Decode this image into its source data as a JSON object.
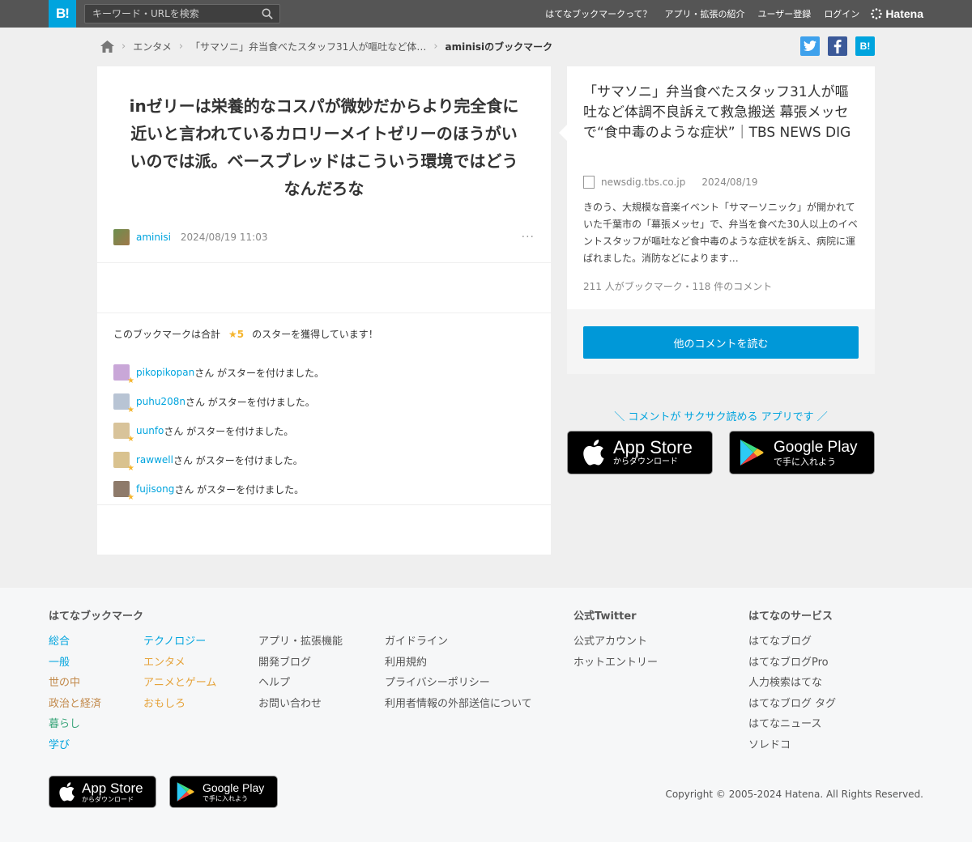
{
  "header": {
    "logo": "B!",
    "search_placeholder": "キーワード・URLを検索",
    "nav": [
      "はてなブックマークって？",
      "アプリ・拡張の紹介",
      "ユーザー登録",
      "ログイン"
    ],
    "brand": "Hatena"
  },
  "breadcrumb": {
    "items": [
      "エンタメ",
      "「サマソニ」弁当食べたスタッフ31人が嘔吐など体…",
      "aminisiのブックマーク"
    ]
  },
  "share": {
    "hatena": "B!"
  },
  "comment": {
    "text": "inゼリーは栄養的なコスパが微妙だからより完全食に近いと言われているカロリーメイトゼリーのほうがいいのでは派。ベースブレッドはこういう環境ではどうなんだろな",
    "user": "aminisi",
    "date": "2024/08/19 11:03",
    "more": "···"
  },
  "stars": {
    "summary_pre": "このブックマークは合計",
    "summary_count": "★5",
    "summary_post": "のスターを獲得しています！",
    "suffix": "さん がスターを付けました。",
    "users": [
      {
        "name": "pikopikopan",
        "color": "#c9a7d8"
      },
      {
        "name": "puhu208n",
        "color": "#b8c4d4"
      },
      {
        "name": "uunfo",
        "color": "#d8c39a"
      },
      {
        "name": "rawwell",
        "color": "#d9c28f"
      },
      {
        "name": "fujisong",
        "color": "#8e7a6a"
      }
    ]
  },
  "entry": {
    "title": "「サマソニ」弁当食べたスタッフ31人が嘔吐など体調不良訴えて救急搬送 幕張メッセで“食中毒のような症状”｜TBS NEWS DIG",
    "domain": "newsdig.tbs.co.jp",
    "date": "2024/08/19",
    "summary": "きのう、大規模な音楽イベント「サマーソニック」が開かれていた千葉市の「幕張メッセ」で、弁当を食べた30人以上のイベントスタッフが嘔吐など食中毒のような症状を訴え、病院に運ばれました。消防などによります…",
    "counts": "211 人がブックマーク・118 件のコメント",
    "cta": "他のコメントを読む"
  },
  "promo": {
    "text": "＼ コメントが サクサク読める アプリです ／",
    "appstore_big": "App Store",
    "appstore_small": "からダウンロード",
    "googleplay_big": "Google Play",
    "googleplay_small": "で手に入れよう"
  },
  "footer": {
    "col1_title": "はてなブックマーク",
    "col1": [
      "総合",
      "一般",
      "世の中",
      "政治と経済",
      "暮らし",
      "学び"
    ],
    "col2": [
      "テクノロジー",
      "エンタメ",
      "アニメとゲーム",
      "おもしろ"
    ],
    "col3": [
      "アプリ・拡張機能",
      "開発ブログ",
      "ヘルプ",
      "お問い合わせ"
    ],
    "col4": [
      "ガイドライン",
      "利用規約",
      "プライバシーポリシー",
      "利用者情報の外部送信について"
    ],
    "twitter_title": "公式Twitter",
    "twitter": [
      "公式アカウント",
      "ホットエントリー"
    ],
    "services_title": "はてなのサービス",
    "services": [
      "はてなブログ",
      "はてなブログPro",
      "人力検索はてな",
      "はてなブログ タグ",
      "はてなニュース",
      "ソレドコ"
    ],
    "copyright": "Copyright © 2005-2024 Hatena. All Rights Reserved."
  }
}
